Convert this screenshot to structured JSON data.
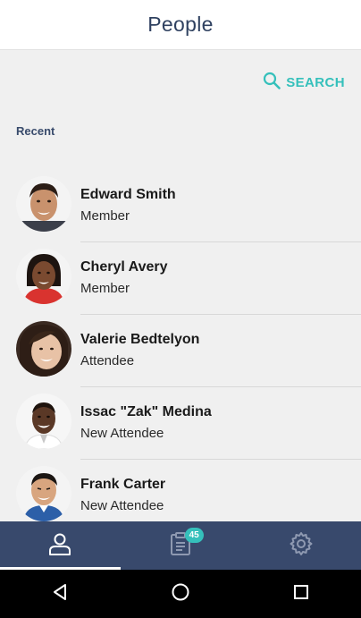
{
  "header": {
    "title": "People"
  },
  "search": {
    "label": "SEARCH",
    "icon": "search-icon",
    "color": "#35c0bb"
  },
  "section": {
    "label": "Recent"
  },
  "people": [
    {
      "name": "Edward Smith",
      "role": "Member"
    },
    {
      "name": "Cheryl Avery",
      "role": "Member"
    },
    {
      "name": "Valerie Bedtelyon",
      "role": "Attendee"
    },
    {
      "name": "Issac \"Zak\" Medina",
      "role": "New Attendee"
    },
    {
      "name": "Frank Carter",
      "role": "New Attendee"
    }
  ],
  "tabbar": {
    "tabs": [
      {
        "icon": "person-icon",
        "active": true
      },
      {
        "icon": "clipboard-icon",
        "badge": "45",
        "active": false
      },
      {
        "icon": "gear-icon",
        "active": false
      }
    ],
    "background": "#38496c"
  },
  "system_nav": {
    "buttons": [
      "back-icon",
      "home-icon",
      "recents-icon"
    ]
  }
}
